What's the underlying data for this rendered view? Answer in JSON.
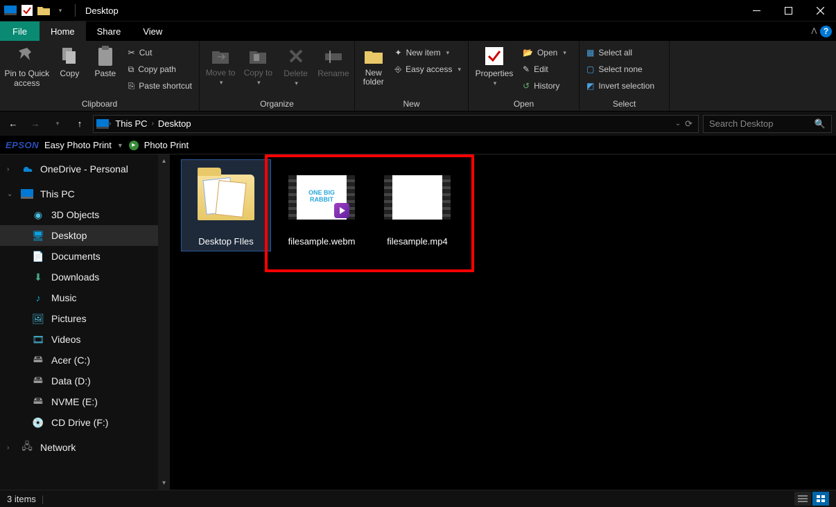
{
  "window": {
    "title": "Desktop"
  },
  "tabs": {
    "file": "File",
    "home": "Home",
    "share": "Share",
    "view": "View"
  },
  "ribbon": {
    "clipboard": {
      "label": "Clipboard",
      "pin": "Pin to Quick access",
      "copy": "Copy",
      "paste": "Paste",
      "cut": "Cut",
      "copy_path": "Copy path",
      "paste_shortcut": "Paste shortcut"
    },
    "organize": {
      "label": "Organize",
      "move_to": "Move to",
      "copy_to": "Copy to",
      "delete": "Delete",
      "rename": "Rename"
    },
    "new": {
      "label": "New",
      "new_folder": "New folder",
      "new_item": "New item",
      "easy_access": "Easy access"
    },
    "open": {
      "label": "Open",
      "properties": "Properties",
      "open": "Open",
      "edit": "Edit",
      "history": "History"
    },
    "select": {
      "label": "Select",
      "select_all": "Select all",
      "select_none": "Select none",
      "invert": "Invert selection"
    }
  },
  "breadcrumb": {
    "root": "This PC",
    "current": "Desktop"
  },
  "search": {
    "placeholder": "Search Desktop"
  },
  "epson": {
    "brand": "EPSON",
    "easy": "Easy Photo Print",
    "photo": "Photo Print"
  },
  "tree": {
    "onedrive": "OneDrive - Personal",
    "thispc": "This PC",
    "objects3d": "3D Objects",
    "desktop": "Desktop",
    "documents": "Documents",
    "downloads": "Downloads",
    "music": "Music",
    "pictures": "Pictures",
    "videos": "Videos",
    "acer": "Acer (C:)",
    "data": "Data (D:)",
    "nvme": "NVME (E:)",
    "cd": "CD Drive (F:)",
    "network": "Network"
  },
  "files": {
    "folder": "Desktop FIles",
    "webm": "filesample.webm",
    "mp4": "filesample.mp4",
    "thumb_text": "ONE BIG RABBIT"
  },
  "status": {
    "count": "3 items"
  }
}
